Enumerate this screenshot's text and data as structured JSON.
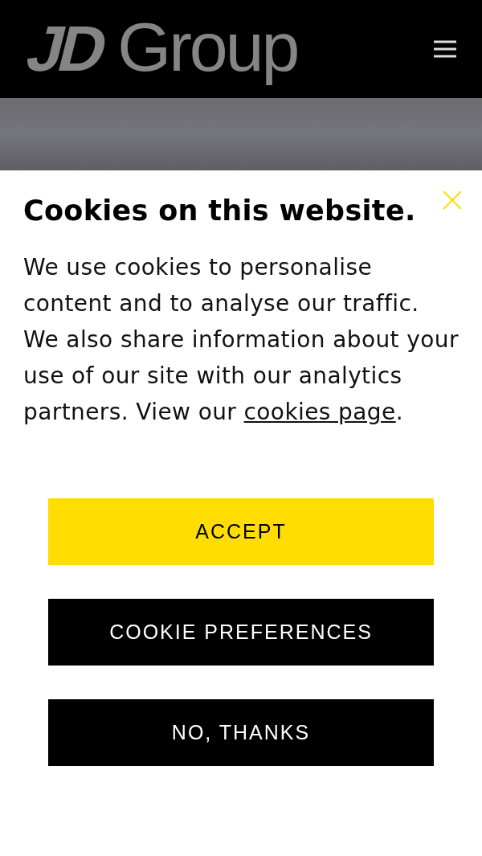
{
  "header": {
    "logo": {
      "mark": "JD",
      "name": "Group"
    }
  },
  "cookie_banner": {
    "title": "Cookies on this website.",
    "body": "We use cookies to personalise content and to analyse our traffic. We also share information about your use of our site with our analytics partners. View our",
    "link": "cookies page",
    "after_link": ".",
    "buttons": [
      {
        "label": "ACCEPT",
        "kind": "primary"
      },
      {
        "label": "COOKIE PREFERENCES",
        "kind": "secondary"
      },
      {
        "label": "NO, THANKS",
        "kind": "secondary"
      }
    ]
  }
}
